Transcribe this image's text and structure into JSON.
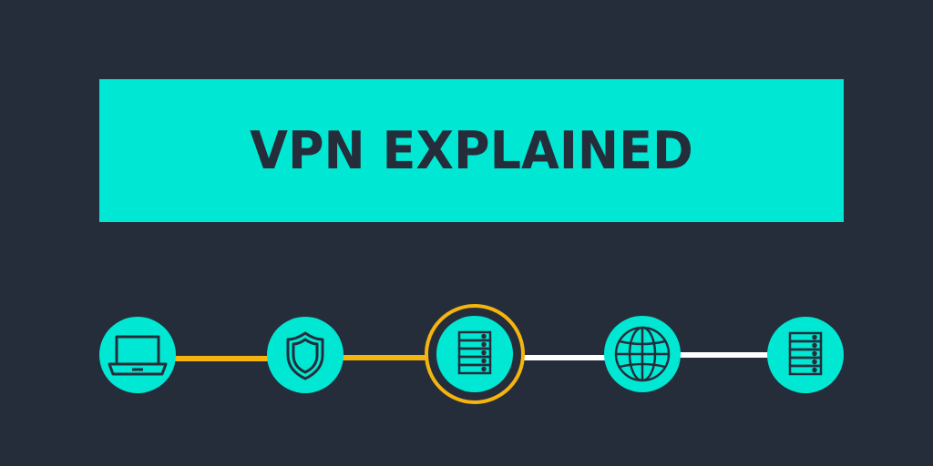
{
  "banner": {
    "title": "VPN EXPLAINED"
  },
  "colors": {
    "background": "#252d3b",
    "accent": "#00e8d3",
    "tunnel": "#f5b50e",
    "open_link": "#ffffff",
    "icon_stroke": "#252d3b"
  },
  "nodes": [
    {
      "icon": "laptop-icon"
    },
    {
      "icon": "shield-icon"
    },
    {
      "icon": "server-icon",
      "highlighted": true
    },
    {
      "icon": "globe-icon"
    },
    {
      "icon": "server-icon"
    }
  ],
  "links": [
    {
      "from": 0,
      "to": 1,
      "type": "encrypted-tunnel"
    },
    {
      "from": 1,
      "to": 2,
      "type": "encrypted-tunnel"
    },
    {
      "from": 2,
      "to": 3,
      "type": "open-internet"
    },
    {
      "from": 3,
      "to": 4,
      "type": "open-internet"
    }
  ]
}
